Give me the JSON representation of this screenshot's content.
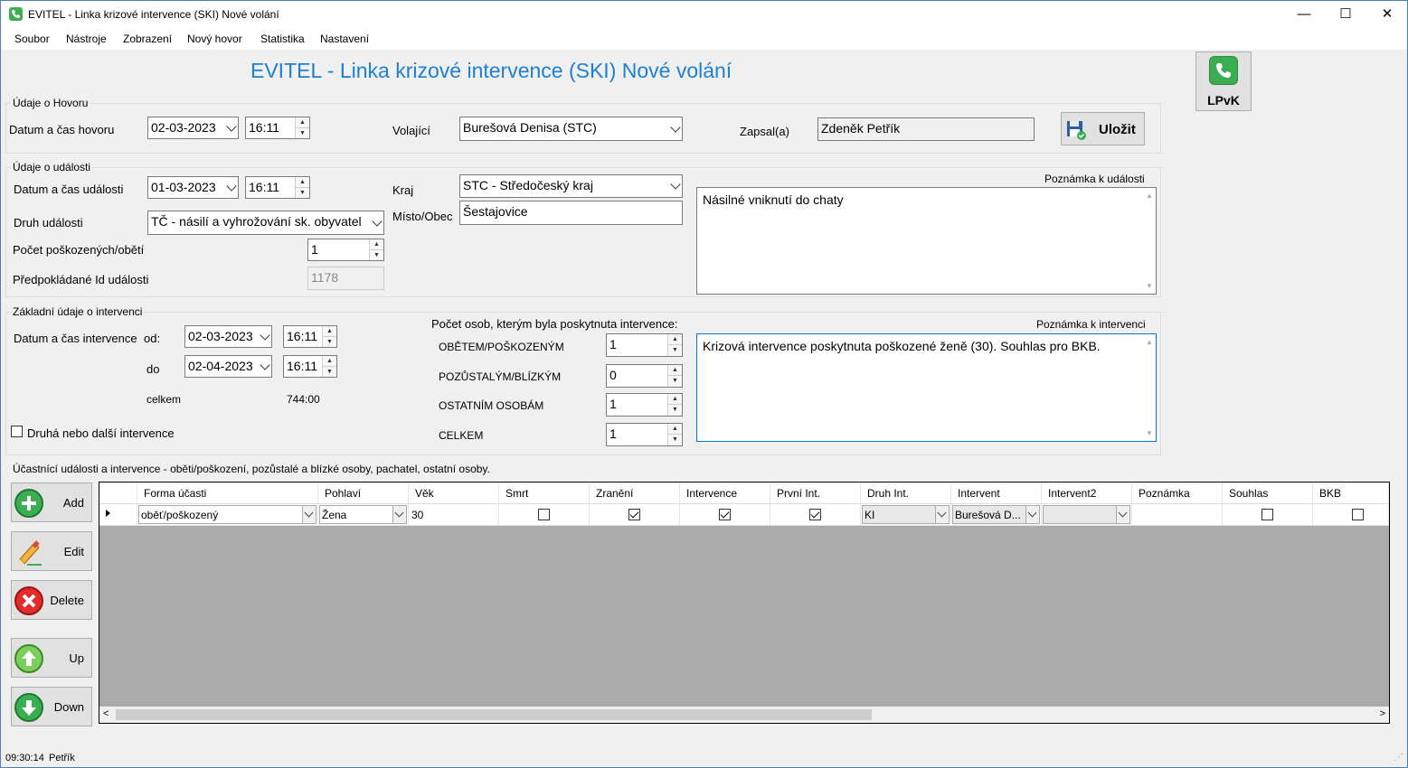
{
  "window": {
    "title": "EVITEL - Linka krizové intervence (SKI) Nové volání"
  },
  "menu": [
    "Soubor",
    "Nástroje",
    "Zobrazení",
    "Nový hovor",
    "Statistika",
    "Nastavení"
  ],
  "header": {
    "title": "EVITEL - Linka krizové intervence (SKI) Nové volání",
    "lpvk_label": "LPvK"
  },
  "call": {
    "group_title": "Údaje o Hovoru",
    "datetime_label": "Datum a čas hovoru",
    "date": "02-03-2023",
    "time": "16:11",
    "caller_label": "Volající",
    "caller": "Burešová  Denisa (STC)",
    "recorder_label": "Zapsal(a)",
    "recorder": "Zdeněk Petřík",
    "save_label": "Uložit"
  },
  "event": {
    "group_title": "Údaje o události",
    "datetime_label": "Datum a čas události",
    "date": "01-03-2023",
    "time": "16:11",
    "type_label": "Druh události",
    "type": "TČ - násilí a vyhrožování sk. obyvatel",
    "victims_label": "Počet poškozených/obětí",
    "victims": "1",
    "expected_id_label": "Předpokládané Id události",
    "expected_id": "1178",
    "region_label": "Kraj",
    "region": "STC - Středočeský kraj",
    "place_label": "Místo/Obec",
    "place": "Šestajovice",
    "note_label": "Poznámka k události",
    "note": "Násilné vniknutí do chaty"
  },
  "intervention": {
    "group_title": "Základní údaje o intervenci",
    "datetime_label": "Datum a čas intervence",
    "from_label": "od:",
    "from_date": "02-03-2023",
    "from_time": "16:11",
    "to_label": "do",
    "to_date": "02-04-2023",
    "to_time": "16:11",
    "total_label": "celkem",
    "total": "744:00",
    "second_label": "Druhá nebo další intervence",
    "count_label": "Počet osob, kterým byla poskytnuta intervence:",
    "victims_label": "OBĚTEM/POŠKOZENÝM",
    "victims": "1",
    "bereaved_label": "POZŮSTALÝM/BLÍZKÝM",
    "bereaved": "0",
    "others_label": "OSTATNÍM OSOBÁM",
    "others": "1",
    "total_persons_label": "CELKEM",
    "total_persons": "1",
    "note_label": "Poznámka k intervenci",
    "note": "Krizová intervence poskytnuta poškozené ženě (30). Souhlas pro BKB."
  },
  "participants": {
    "title": "Účastnící události a intervence - oběti/poškození, pozůstalé a blízké osoby, pachatel, ostatní osoby.",
    "buttons": {
      "add": "Add",
      "edit": "Edit",
      "delete": "Delete",
      "up": "Up",
      "down": "Down"
    },
    "columns": [
      "Forma účasti",
      "Pohlaví",
      "Věk",
      "Smrt",
      "Zranění",
      "Intervence",
      "První Int.",
      "Druh Int.",
      "Intervent",
      "Intervent2",
      "Poznámka",
      "Souhlas",
      "BKB"
    ],
    "row": {
      "forma": "oběť/poškozený",
      "pohlavi": "Žena",
      "vek": "30",
      "smrt": false,
      "zraneni": true,
      "intervence": true,
      "prvni": true,
      "druh": "KI",
      "intervent": "Burešová  D...",
      "intervent2": "",
      "poznamka": "",
      "souhlas": false,
      "bkb": false
    }
  },
  "status": {
    "time": "09:30:14",
    "user": "Petřík"
  },
  "colors": {
    "title_blue": "#1e7fd2",
    "green_icon": "#3cae52",
    "grid_bg": "#ababab"
  }
}
